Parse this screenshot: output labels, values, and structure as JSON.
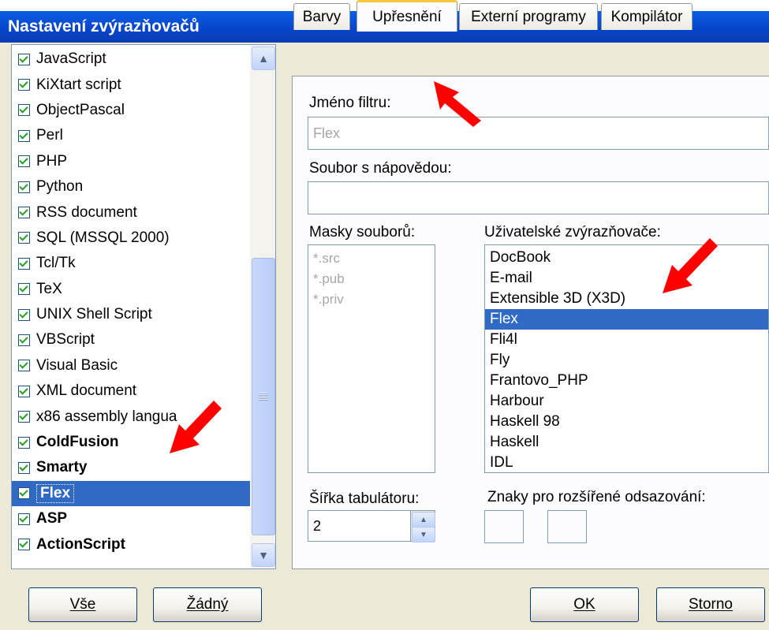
{
  "window": {
    "title": "Nastavení zvýrazňovačů"
  },
  "highlighters": [
    {
      "label": "JavaScript",
      "checked": true,
      "bold": false
    },
    {
      "label": "KiXtart script",
      "checked": true,
      "bold": false
    },
    {
      "label": "ObjectPascal",
      "checked": true,
      "bold": false
    },
    {
      "label": "Perl",
      "checked": true,
      "bold": false
    },
    {
      "label": "PHP",
      "checked": true,
      "bold": false
    },
    {
      "label": "Python",
      "checked": true,
      "bold": false
    },
    {
      "label": "RSS document",
      "checked": true,
      "bold": false
    },
    {
      "label": "SQL (MSSQL 2000)",
      "checked": true,
      "bold": false
    },
    {
      "label": "Tcl/Tk",
      "checked": true,
      "bold": false
    },
    {
      "label": "TeX",
      "checked": true,
      "bold": false
    },
    {
      "label": "UNIX Shell Script",
      "checked": true,
      "bold": false
    },
    {
      "label": "VBScript",
      "checked": true,
      "bold": false
    },
    {
      "label": "Visual Basic",
      "checked": true,
      "bold": false
    },
    {
      "label": "XML document",
      "checked": true,
      "bold": false
    },
    {
      "label": "x86 assembly langua",
      "checked": true,
      "bold": false
    },
    {
      "label": "ColdFusion",
      "checked": true,
      "bold": true
    },
    {
      "label": "Smarty",
      "checked": true,
      "bold": true
    },
    {
      "label": "Flex",
      "checked": true,
      "bold": true,
      "selected": true
    },
    {
      "label": "ASP",
      "checked": true,
      "bold": true
    },
    {
      "label": "ActionScript",
      "checked": true,
      "bold": true
    }
  ],
  "tabs": [
    {
      "label": "Barvy"
    },
    {
      "label": "Upřesnění",
      "active": true
    },
    {
      "label": "Externí programy"
    },
    {
      "label": "Kompilátor"
    }
  ],
  "form": {
    "filter_name_label": "Jméno filtru:",
    "filter_name_value": "Flex",
    "help_file_label": "Soubor s nápovědou:",
    "help_file_value": "",
    "masks_label": "Masky souborů:",
    "masks": [
      "*.src",
      "*.pub",
      "*.priv"
    ],
    "user_highlighters_label": "Uživatelské zvýrazňovače:",
    "user_highlighters": [
      "DocBook",
      "E-mail",
      "Extensible 3D (X3D)",
      "Flex",
      "Fli4l",
      "Fly",
      "Frantovo_PHP",
      "Harbour",
      "Haskell 98",
      "Haskell",
      "IDL"
    ],
    "user_highlighters_selected": "Flex",
    "tab_width_label": "Šířka tabulátoru:",
    "tab_width_value": "2",
    "indent_chars_label": "Znaky pro rozšířené odsazování:",
    "indent_char_1": "",
    "indent_char_2": ""
  },
  "buttons": {
    "all": "Vše",
    "none": "Žádný",
    "ok": "OK",
    "cancel": "Storno"
  },
  "colors": {
    "title_bar": "#0a4fd6",
    "selection": "#316ac5",
    "arrow": "#ff0000",
    "tab_highlight": "#ffc83c"
  }
}
